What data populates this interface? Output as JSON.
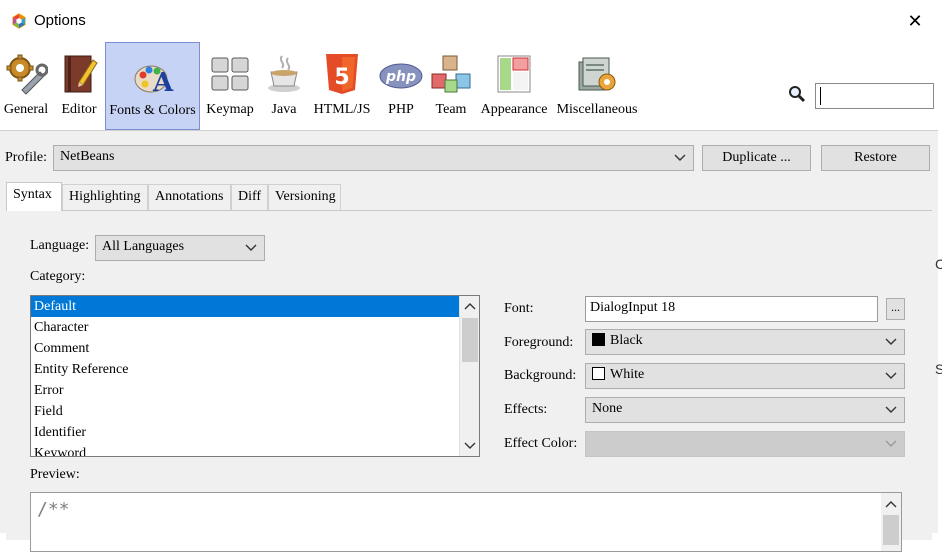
{
  "window": {
    "title": "Options"
  },
  "toolbar": {
    "items": [
      {
        "label": "General",
        "icon": "gear-wrench-icon"
      },
      {
        "label": "Editor",
        "icon": "book-pencil-icon"
      },
      {
        "label": "Fonts & Colors",
        "icon": "palette-font-icon",
        "selected": true
      },
      {
        "label": "Keymap",
        "icon": "keyboard-icon"
      },
      {
        "label": "Java",
        "icon": "java-cup-icon"
      },
      {
        "label": "HTML/JS",
        "icon": "html5-icon"
      },
      {
        "label": "PHP",
        "icon": "php-icon"
      },
      {
        "label": "Team",
        "icon": "team-cubes-icon"
      },
      {
        "label": "Appearance",
        "icon": "appearance-panels-icon"
      },
      {
        "label": "Miscellaneous",
        "icon": "misc-folder-icon"
      }
    ],
    "php_logo_text": "php",
    "html5_logo_text": "5"
  },
  "search": {
    "value": ""
  },
  "profile": {
    "label": "Profile:",
    "value": "NetBeans",
    "duplicate_label": "Duplicate ...",
    "restore_label": "Restore"
  },
  "tabs": [
    {
      "label": "Syntax",
      "active": true
    },
    {
      "label": "Highlighting"
    },
    {
      "label": "Annotations"
    },
    {
      "label": "Diff"
    },
    {
      "label": "Versioning"
    }
  ],
  "syntax": {
    "language_label": "Language:",
    "language_value": "All Languages",
    "category_label": "Category:",
    "categories": [
      "Default",
      "Character",
      "Comment",
      "Entity Reference",
      "Error",
      "Field",
      "Identifier",
      "Keyword"
    ],
    "selected_index": 0,
    "font_label": "Font:",
    "font_value": "DialogInput 18",
    "font_button": "...",
    "foreground_label": "Foreground:",
    "foreground_value": "Black",
    "foreground_color": "#000000",
    "background_label": "Background:",
    "background_value": "White",
    "background_color": "#ffffff",
    "effects_label": "Effects:",
    "effects_value": "None",
    "effect_color_label": "Effect Color:",
    "effect_color_value": "",
    "preview_label": "Preview:",
    "preview_text": "/**"
  },
  "edge_chars": [
    "C",
    "S"
  ],
  "colors": {
    "selection": "#0078d7",
    "selected_tool": "#c7d3f5"
  }
}
